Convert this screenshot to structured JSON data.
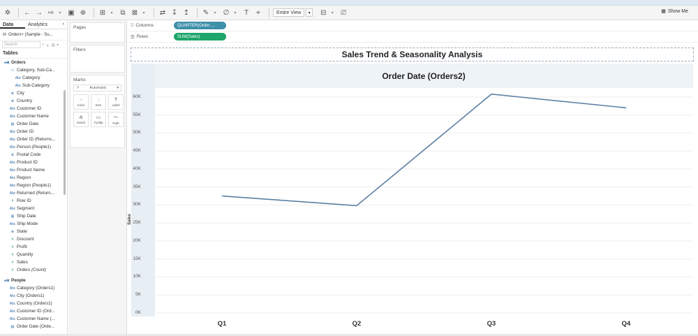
{
  "toolbar": {
    "view_select": "Entire View",
    "show_me": "Show Me",
    "icons": [
      "tableau-logo-icon",
      "undo-icon",
      "redo-icon",
      "refresh-icon",
      "save-icon",
      "new-datasource-icon",
      "new-worksheet-icon",
      "duplicate-icon",
      "clear-sheet-icon",
      "swap-icon",
      "sort-asc-icon",
      "sort-desc-icon",
      "highlight-icon",
      "group-icon",
      "label-icon",
      "pin-icon",
      "dropdown-caret-icon",
      "show-cards-icon",
      "presentation-icon",
      "show-me-icon"
    ]
  },
  "data_pane": {
    "tab_data": "Data",
    "tab_analytics": "Analytics",
    "collapse": "‹",
    "datasource": "Orders+ (Sample - Su...",
    "search_placeholder": "Search",
    "tables_label": "Tables",
    "groups": [
      {
        "name": "Orders",
        "fields": [
          {
            "name": "Category, Sub-Ca...",
            "icon": "hierarchy-icon",
            "level": 2
          },
          {
            "name": "Category",
            "icon": "abc-icon",
            "level": 3
          },
          {
            "name": "Sub-Category",
            "icon": "abc-icon",
            "level": 3
          },
          {
            "name": "City",
            "icon": "globe-icon",
            "level": 2
          },
          {
            "name": "Country",
            "icon": "globe-icon",
            "level": 2
          },
          {
            "name": "Customer ID",
            "icon": "abc-icon",
            "level": 2
          },
          {
            "name": "Customer Name",
            "icon": "abc-icon",
            "level": 2
          },
          {
            "name": "Order Date",
            "icon": "calendar-icon",
            "level": 2
          },
          {
            "name": "Order ID",
            "icon": "abc-icon",
            "level": 2
          },
          {
            "name": "Order ID (Returns...",
            "icon": "abc-icon",
            "level": 2
          },
          {
            "name": "Person (People1)",
            "icon": "abc-icon",
            "level": 2
          },
          {
            "name": "Postal Code",
            "icon": "globe-icon",
            "level": 2
          },
          {
            "name": "Product ID",
            "icon": "abc-icon",
            "level": 2
          },
          {
            "name": "Product Name",
            "icon": "abc-icon",
            "level": 2
          },
          {
            "name": "Region",
            "icon": "abc-icon",
            "level": 2
          },
          {
            "name": "Region (People1)",
            "icon": "abc-icon",
            "level": 2
          },
          {
            "name": "Returned (Return...",
            "icon": "abc-icon",
            "level": 2
          },
          {
            "name": "Row ID",
            "icon": "number-icon",
            "level": 2
          },
          {
            "name": "Segment",
            "icon": "abc-icon",
            "level": 2
          },
          {
            "name": "Ship Date",
            "icon": "calendar-icon",
            "level": 2
          },
          {
            "name": "Ship Mode",
            "icon": "abc-icon",
            "level": 2
          },
          {
            "name": "State",
            "icon": "globe-icon",
            "level": 2
          },
          {
            "name": "Discount",
            "icon": "number-icon",
            "level": 2
          },
          {
            "name": "Profit",
            "icon": "number-icon",
            "level": 2
          },
          {
            "name": "Quantity",
            "icon": "number-icon",
            "level": 2
          },
          {
            "name": "Sales",
            "icon": "number-icon",
            "level": 2
          },
          {
            "name": "Orders (Count)",
            "icon": "number-icon",
            "level": 2,
            "italic": true
          }
        ]
      },
      {
        "name": "People",
        "fields": [
          {
            "name": "Category (Orders1)",
            "icon": "abc-icon",
            "level": 2
          },
          {
            "name": "City (Orders1)",
            "icon": "abc-icon",
            "level": 2
          },
          {
            "name": "Country (Orders1)",
            "icon": "abc-icon",
            "level": 2
          },
          {
            "name": "Customer ID (Ord...",
            "icon": "abc-icon",
            "level": 2
          },
          {
            "name": "Customer Name (...",
            "icon": "abc-icon",
            "level": 2
          },
          {
            "name": "Order Date (Orde...",
            "icon": "calendar-icon",
            "level": 2
          }
        ]
      }
    ]
  },
  "cards": {
    "pages": "Pages",
    "filters": "Filters",
    "marks": "Marks",
    "mark_type": "Automatic",
    "mark_buttons": [
      {
        "label": "Color",
        "icon": "color-icon"
      },
      {
        "label": "Size",
        "icon": "size-icon"
      },
      {
        "label": "Label",
        "icon": "label-icon"
      },
      {
        "label": "Detail",
        "icon": "detail-icon"
      },
      {
        "label": "Tooltip",
        "icon": "tooltip-icon"
      },
      {
        "label": "Path",
        "icon": "path-icon"
      }
    ]
  },
  "shelves": {
    "columns_label": "Columns",
    "columns_pill": "QUARTER(Order ...",
    "rows_label": "Rows",
    "rows_pill": "SUM(Sales)"
  },
  "colors": {
    "line": "#5a7fa3",
    "dimension_pill": "#3f8fa9",
    "measure_pill": "#1ea56a"
  },
  "viz": {
    "title": "Sales Trend & Seasonality Analysis",
    "header": "Order Date (Orders2)"
  },
  "chart_data": {
    "type": "line",
    "title": "Sales Trend & Seasonality Analysis",
    "xlabel": "Order Date (Orders2)",
    "ylabel": "Sales",
    "categories": [
      "Q1",
      "Q2",
      "Q3",
      "Q4"
    ],
    "values": [
      32500,
      29800,
      60800,
      57000
    ],
    "ylim": [
      0,
      62500
    ],
    "yticks": [
      "0K",
      "5K",
      "10K",
      "15K",
      "20K",
      "25K",
      "30K",
      "35K",
      "40K",
      "45K",
      "50K",
      "55K",
      "60K"
    ],
    "ytick_values": [
      0,
      5000,
      10000,
      15000,
      20000,
      25000,
      30000,
      35000,
      40000,
      45000,
      50000,
      55000,
      60000
    ],
    "grid": true
  }
}
